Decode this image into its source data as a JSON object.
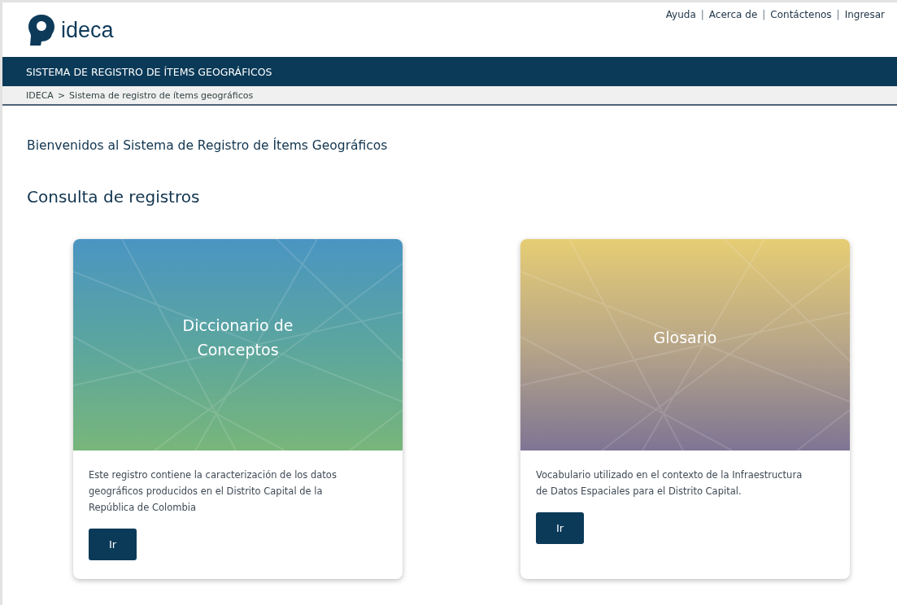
{
  "header": {
    "logo_text": "ideca",
    "top_links": [
      {
        "kind": "link",
        "label": "Ayuda"
      },
      {
        "kind": "separator",
        "label": "|"
      },
      {
        "kind": "link",
        "label": "Acerca de"
      },
      {
        "kind": "separator",
        "label": "|"
      },
      {
        "kind": "link",
        "label": "Contáctenos"
      },
      {
        "kind": "separator",
        "label": "|"
      },
      {
        "kind": "link",
        "label": "Ingresar"
      }
    ]
  },
  "title_bar": {
    "title": "SISTEMA DE REGISTRO DE ÍTEMS GEOGRÁFICOS"
  },
  "breadcrumb": {
    "items": [
      "IDECA",
      ">",
      "Sistema de registro de ítems geográficos"
    ]
  },
  "welcome": "Bienvenidos al Sistema de Registro de Ítems Geográficos",
  "section_title": "Consulta de registros",
  "cards": [
    {
      "kind": "dictionary",
      "title": "Diccionario de Conceptos",
      "description": "Este registro contiene la caracterización de los datos geográficos producidos en el Distrito Capital de la República de Colombia",
      "button": "Ir"
    },
    {
      "kind": "glossary",
      "title": "Glosario",
      "description": "Vocabulario utilizado en el contexto de la Infraestructura de Datos Espaciales para el Distrito Capital.",
      "button": "Ir"
    }
  ]
}
